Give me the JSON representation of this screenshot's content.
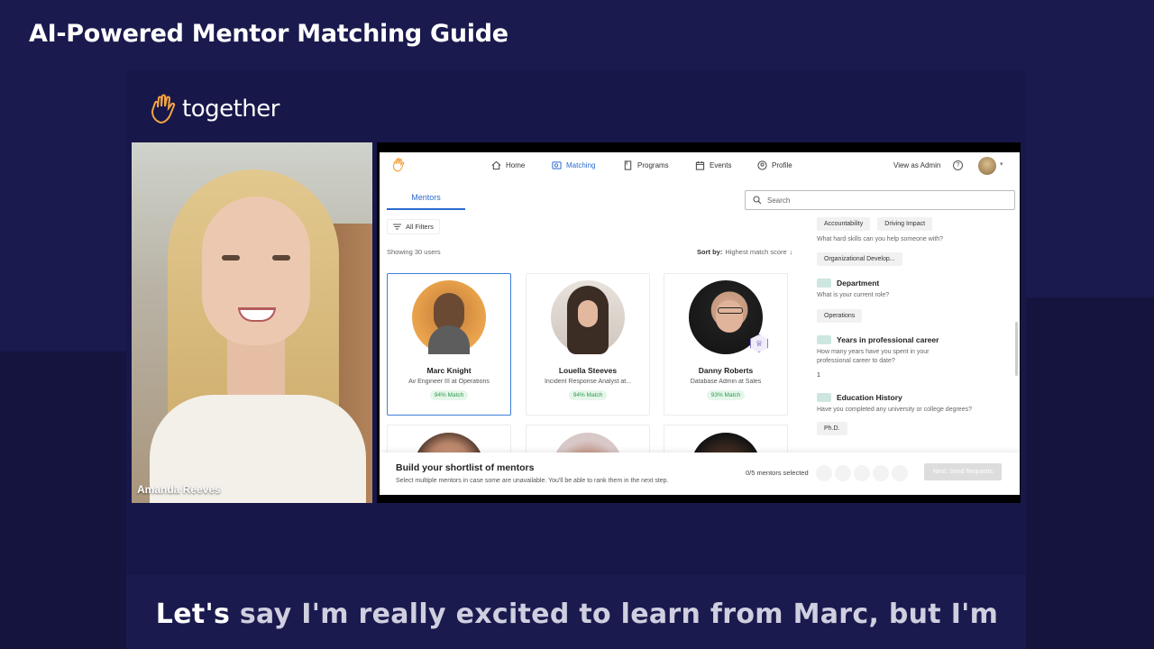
{
  "video": {
    "title": "AI-Powered Mentor Matching Guide",
    "brand": "together",
    "speaker_name": "Amanda Reeves",
    "caption_highlight": "Let's",
    "caption_rest": " say I'm really excited to learn from Marc, but I'm"
  },
  "nav": {
    "items": [
      {
        "label": "Home",
        "icon": "home-icon"
      },
      {
        "label": "Matching",
        "icon": "matching-icon",
        "active": true
      },
      {
        "label": "Programs",
        "icon": "programs-icon"
      },
      {
        "label": "Events",
        "icon": "events-icon"
      },
      {
        "label": "Profile",
        "icon": "profile-icon"
      }
    ],
    "admin_label": "View as Admin",
    "help_glyph": "?"
  },
  "tabs": {
    "mentors": "Mentors"
  },
  "search": {
    "placeholder": "Search"
  },
  "filters": {
    "label": "All Filters"
  },
  "list": {
    "showing": "Showing 30 users",
    "sort_prefix": "Sort by:",
    "sort_value": "Highest match score"
  },
  "mentors": [
    {
      "name": "Marc Knight",
      "role": "Av Engineer III at Operations",
      "match": "94% Match"
    },
    {
      "name": "Louella Steeves",
      "role": "Incident Response Analyst at...",
      "match": "94% Match"
    },
    {
      "name": "Danny Roberts",
      "role": "Database Admin at Sales",
      "match": "93% Match"
    }
  ],
  "panel": {
    "top_chips": [
      "Accountability",
      "Driving Impact"
    ],
    "hard_skills_q": "What hard skills can you help someone with?",
    "hard_skills_chip": "Organizational Develop...",
    "department_title": "Department",
    "department_q": "What is your current role?",
    "department_chip": "Operations",
    "years_title": "Years in professional career",
    "years_q": "How many years have you spent in your professional career to date?",
    "years_value": "1",
    "education_title": "Education History",
    "education_q": "Have you completed any university or college degrees?",
    "education_chip": "Ph.D."
  },
  "bottom_bar": {
    "title": "Build your shortlist of mentors",
    "subtitle": "Select multiple mentors in case some are unavailable. You'll be able to rank them in the next step.",
    "count": "0/5 mentors selected",
    "next_label": "Next: Send Requests"
  },
  "colors": {
    "accent": "#2a6ad0",
    "match_green": "#2e9a4f",
    "background": "#1a1a4e"
  }
}
